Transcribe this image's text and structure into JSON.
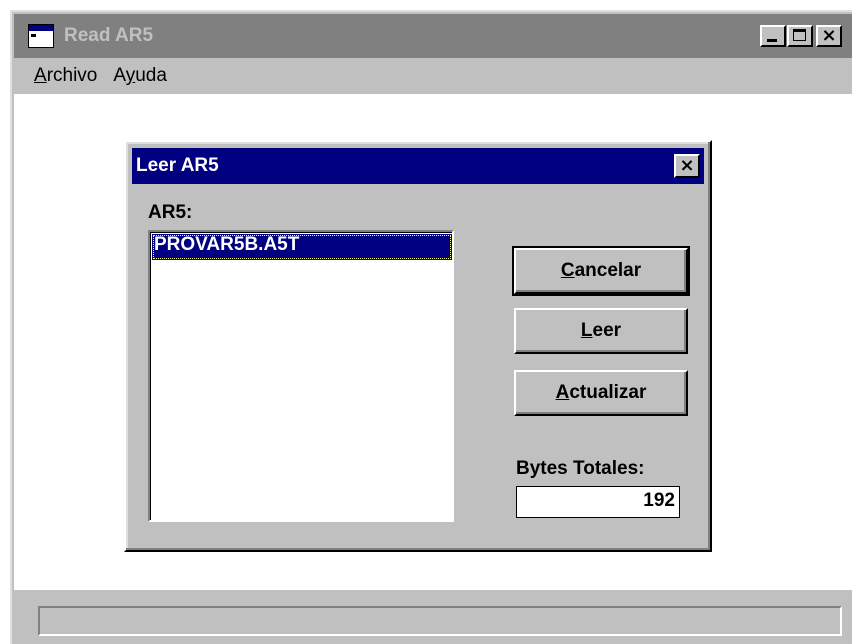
{
  "window": {
    "title": "Read AR5",
    "controls": {
      "minimize": "_",
      "maximize": "□",
      "close": "×"
    }
  },
  "menu": {
    "items": [
      {
        "label_pre": "",
        "label_ul": "A",
        "label_post": "rchivo"
      },
      {
        "label_pre": "A",
        "label_ul": "y",
        "label_post": "uda"
      }
    ]
  },
  "dialog": {
    "title": "Leer AR5",
    "close_glyph": "×",
    "list_label": "AR5:",
    "list_items": [
      "PROVAR5B.A5T"
    ],
    "buttons": {
      "cancel": {
        "ul": "C",
        "rest": "ancelar"
      },
      "read": {
        "ul": "L",
        "rest": "eer"
      },
      "update": {
        "ul": "A",
        "rest": "ctualizar"
      }
    },
    "bytes_label": "Bytes Totales:",
    "bytes_value": "192"
  },
  "colors": {
    "face": "#c0c0c0",
    "active_title": "#000080",
    "inactive_title": "#808080",
    "selection": "#000080"
  }
}
